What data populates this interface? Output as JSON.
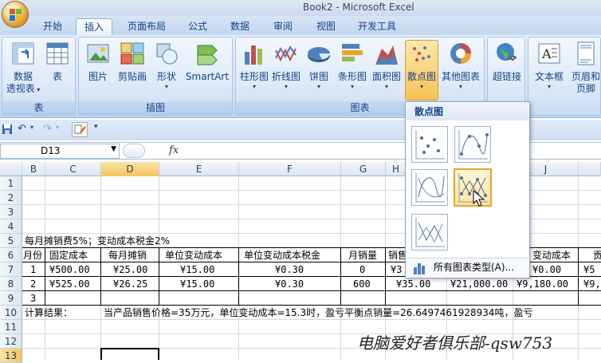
{
  "window": {
    "title": "Book2 - Microsoft Excel"
  },
  "tabs": [
    "开始",
    "插入",
    "页面布局",
    "公式",
    "数据",
    "审阅",
    "视图",
    "开发工具"
  ],
  "active_tab": "插入",
  "ribbon": {
    "groups": {
      "table": {
        "label": "表",
        "items": {
          "pivot_line1": "数据",
          "pivot_line2": "透视表",
          "table": "表"
        }
      },
      "illustrations": {
        "label": "插图",
        "items": {
          "picture": "图片",
          "clipart": "剪贴画",
          "shapes": "形状",
          "smartart": "SmartArt"
        }
      },
      "charts": {
        "label": "图表",
        "items": {
          "column": "柱形图",
          "line": "折线图",
          "pie": "饼图",
          "bar": "条形图",
          "area": "面积图",
          "scatter": "散点图",
          "other": "其他图表"
        }
      },
      "links": {
        "label": "",
        "items": {
          "hyperlink": "超链接"
        }
      },
      "text": {
        "label": "",
        "items": {
          "textbox": "文本框",
          "header_line1": "页眉和",
          "header_line2": "页脚"
        }
      }
    }
  },
  "formula_bar": {
    "name_box": "D13",
    "fx": "fx"
  },
  "columns": [
    "B",
    "C",
    "D",
    "E",
    "F",
    "G",
    "H",
    "I",
    "J"
  ],
  "rows": [
    "1",
    "2",
    "3",
    "4",
    "5",
    "6",
    "7",
    "8",
    "9",
    "10",
    "11",
    "12",
    "13"
  ],
  "cells": {
    "r5": "每月摊销费5%；变动成本税金2%",
    "r6": {
      "b": "月份",
      "c": "固定成本",
      "d": "每月摊销",
      "e": "单位变动成本",
      "f": "单位变动成本税金",
      "g": "月销量",
      "h": "销售",
      "j": "变动成本",
      "k": "贡"
    },
    "r7": {
      "b": "1",
      "c": "¥500.00",
      "d": "¥25.00",
      "e": "¥15.00",
      "f": "¥0.30",
      "g": "0",
      "h": "¥3",
      "j": "¥0.00",
      "k": "¥5"
    },
    "r8": {
      "b": "2",
      "c": "¥525.00",
      "d": "¥26.25",
      "e": "¥15.00",
      "f": "¥0.30",
      "g": "600",
      "h": "¥35.00",
      "i": "¥21,000.00",
      "j": "¥9,180.00",
      "k": "¥9,"
    },
    "r9": {
      "b": "3"
    },
    "r10": {
      "label": "计算结果：",
      "text": "当产品销售价格=35万元，单位变动成本=15.3时，盈亏平衡点销量=26.6497461928934吨，盈亏"
    }
  },
  "scatter_menu": {
    "title": "散点图",
    "thumbs": [
      "scatter-markers-only",
      "scatter-smooth-lines-markers",
      "scatter-smooth-lines",
      "scatter-straight-lines-markers",
      "scatter-straight-lines"
    ],
    "selected": "scatter-straight-lines-markers",
    "footer": "所有图表类型(A)..."
  },
  "watermark": "电脑爱好者俱乐部-qsw753",
  "colors": {
    "ribbon_text": "#15428b",
    "selected_highlight": "#f8c254"
  }
}
